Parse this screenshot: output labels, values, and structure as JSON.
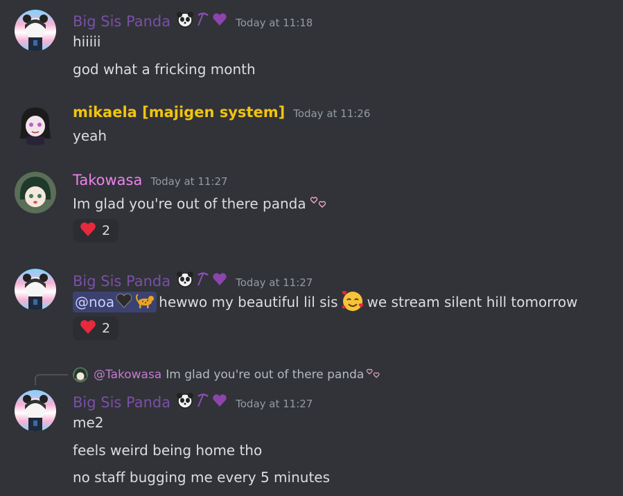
{
  "messages": [
    {
      "username": "Big Sis Panda",
      "timestamp": "Today at 11:18",
      "lines": [
        "hiiiii",
        "god what a fricking month"
      ]
    },
    {
      "username": "mikaela [majigen system]",
      "timestamp": "Today at 11:26",
      "lines": [
        "yeah"
      ]
    },
    {
      "username": "Takowasa",
      "timestamp": "Today at 11:27",
      "lines": [
        "Im glad you're out of there panda"
      ],
      "reaction": {
        "emoji": "heart",
        "count": "2"
      }
    },
    {
      "username": "Big Sis Panda",
      "timestamp": "Today at 11:27",
      "mention": "@noa",
      "text_a": "hewwo my beautiful lil sis",
      "text_b": "we stream silent hill tomorrow",
      "reaction": {
        "emoji": "heart",
        "count": "2"
      }
    },
    {
      "reply": {
        "mention": "@Takowasa",
        "text": "Im glad you're out of there panda"
      },
      "username": "Big Sis Panda",
      "timestamp": "Today at 11:27",
      "lines": [
        "me2",
        "feels weird being home tho",
        "no staff bugging me every 5 minutes"
      ]
    }
  ],
  "colors": {
    "background": "#313338",
    "panda_name": "#7b4fa7",
    "mikaela_name": "#f1c40f",
    "takowasa_name": "#ee82ee",
    "mention_bg": "#3c4270",
    "reaction_bg": "#2b2d31"
  },
  "icons": [
    "panda-face-icon",
    "pickaxe-icon",
    "purple-heart-icon",
    "red-heart-icon",
    "black-heart-icon",
    "leopard-icon",
    "smiling-hearts-face-icon",
    "sparkle-hearts-icon"
  ]
}
